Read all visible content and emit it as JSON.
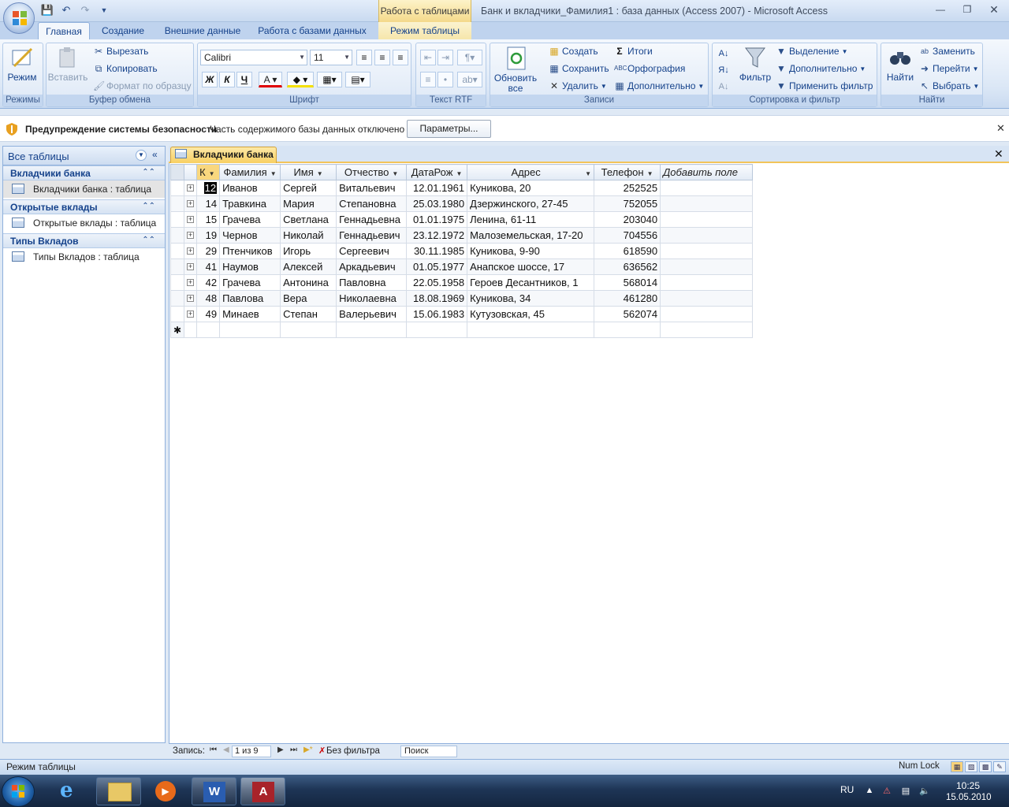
{
  "window": {
    "context_tab": "Работа с таблицами",
    "title": "Банк и вкладчики_Фамилия1 : база данных (Access 2007) - Microsoft Access"
  },
  "tabs": [
    "Главная",
    "Создание",
    "Внешние данные",
    "Работа с базами данных",
    "Режим таблицы"
  ],
  "ribbon": {
    "modes": {
      "label": "Режимы",
      "mode": "Режим"
    },
    "clipboard": {
      "label": "Буфер обмена",
      "paste": "Вставить",
      "cut": "Вырезать",
      "copy": "Копировать",
      "format_painter": "Формат по образцу"
    },
    "font": {
      "label": "Шрифт",
      "font_name": "Calibri",
      "font_size": "11",
      "bold": "Ж",
      "italic": "К",
      "underline": "Ч"
    },
    "rtf": {
      "label": "Текст RTF"
    },
    "records": {
      "label": "Записи",
      "refresh": "Обновить все",
      "create": "Создать",
      "save": "Сохранить",
      "delete": "Удалить",
      "totals": "Итоги",
      "spelling": "Орфография",
      "more": "Дополнительно"
    },
    "sort_filter": {
      "label": "Сортировка и фильтр",
      "filter": "Фильтр",
      "selection": "Выделение",
      "advanced": "Дополнительно",
      "apply_filter": "Применить фильтр"
    },
    "find": {
      "label": "Найти",
      "find": "Найти",
      "replace": "Заменить",
      "goto": "Перейти",
      "select": "Выбрать"
    }
  },
  "security": {
    "title": "Предупреждение системы безопасности",
    "text": "Часть содержимого базы данных отключено",
    "button": "Параметры..."
  },
  "nav": {
    "header": "Все таблицы",
    "groups": [
      {
        "name": "Вкладчики банка",
        "item": "Вкладчики банка : таблица"
      },
      {
        "name": "Открытые вклады",
        "item": "Открытые вклады : таблица"
      },
      {
        "name": "Типы Вкладов",
        "item": "Типы Вкладов : таблица"
      }
    ]
  },
  "document": {
    "tab": "Вкладчики банка"
  },
  "table": {
    "columns": [
      "К",
      "Фамилия",
      "Имя",
      "Отчество",
      "ДатаРож",
      "Адрес",
      "Телефон",
      "Добавить поле"
    ],
    "rows": [
      [
        "12",
        "Иванов",
        "Сергей",
        "Витальевич",
        "12.01.1961",
        "Куникова, 20",
        "252525"
      ],
      [
        "14",
        "Травкина",
        "Мария",
        "Степановна",
        "25.03.1980",
        "Дзержинского, 27-45",
        "752055"
      ],
      [
        "15",
        "Грачева",
        "Светлана",
        "Геннадьевна",
        "01.01.1975",
        "Ленина, 61-11",
        "203040"
      ],
      [
        "19",
        "Чернов",
        "Николай",
        "Геннадьевич",
        "23.12.1972",
        "Малоземельская, 17-20",
        "704556"
      ],
      [
        "29",
        "Птенчиков",
        "Игорь",
        "Сергеевич",
        "30.11.1985",
        "Куникова, 9-90",
        "618590"
      ],
      [
        "41",
        "Наумов",
        "Алексей",
        "Аркадьевич",
        "01.05.1977",
        "Анапское шоссе, 17",
        "636562"
      ],
      [
        "42",
        "Грачева",
        "Антонина",
        "Павловна",
        "22.05.1958",
        "Героев Десантников, 1",
        "568014"
      ],
      [
        "48",
        "Павлова",
        "Вера",
        "Николаевна",
        "18.08.1969",
        "Куникова, 34",
        "461280"
      ],
      [
        "49",
        "Минаев",
        "Степан",
        "Валерьевич",
        "15.06.1983",
        "Кутузовская, 45",
        "562074"
      ]
    ]
  },
  "record_nav": {
    "label": "Запись:",
    "position": "1 из 9",
    "filter": "Без фильтра",
    "search": "Поиск"
  },
  "status": {
    "mode": "Режим таблицы",
    "numlock": "Num Lock"
  },
  "taskbar": {
    "lang": "RU",
    "time": "10:25",
    "date": "15.05.2010"
  }
}
